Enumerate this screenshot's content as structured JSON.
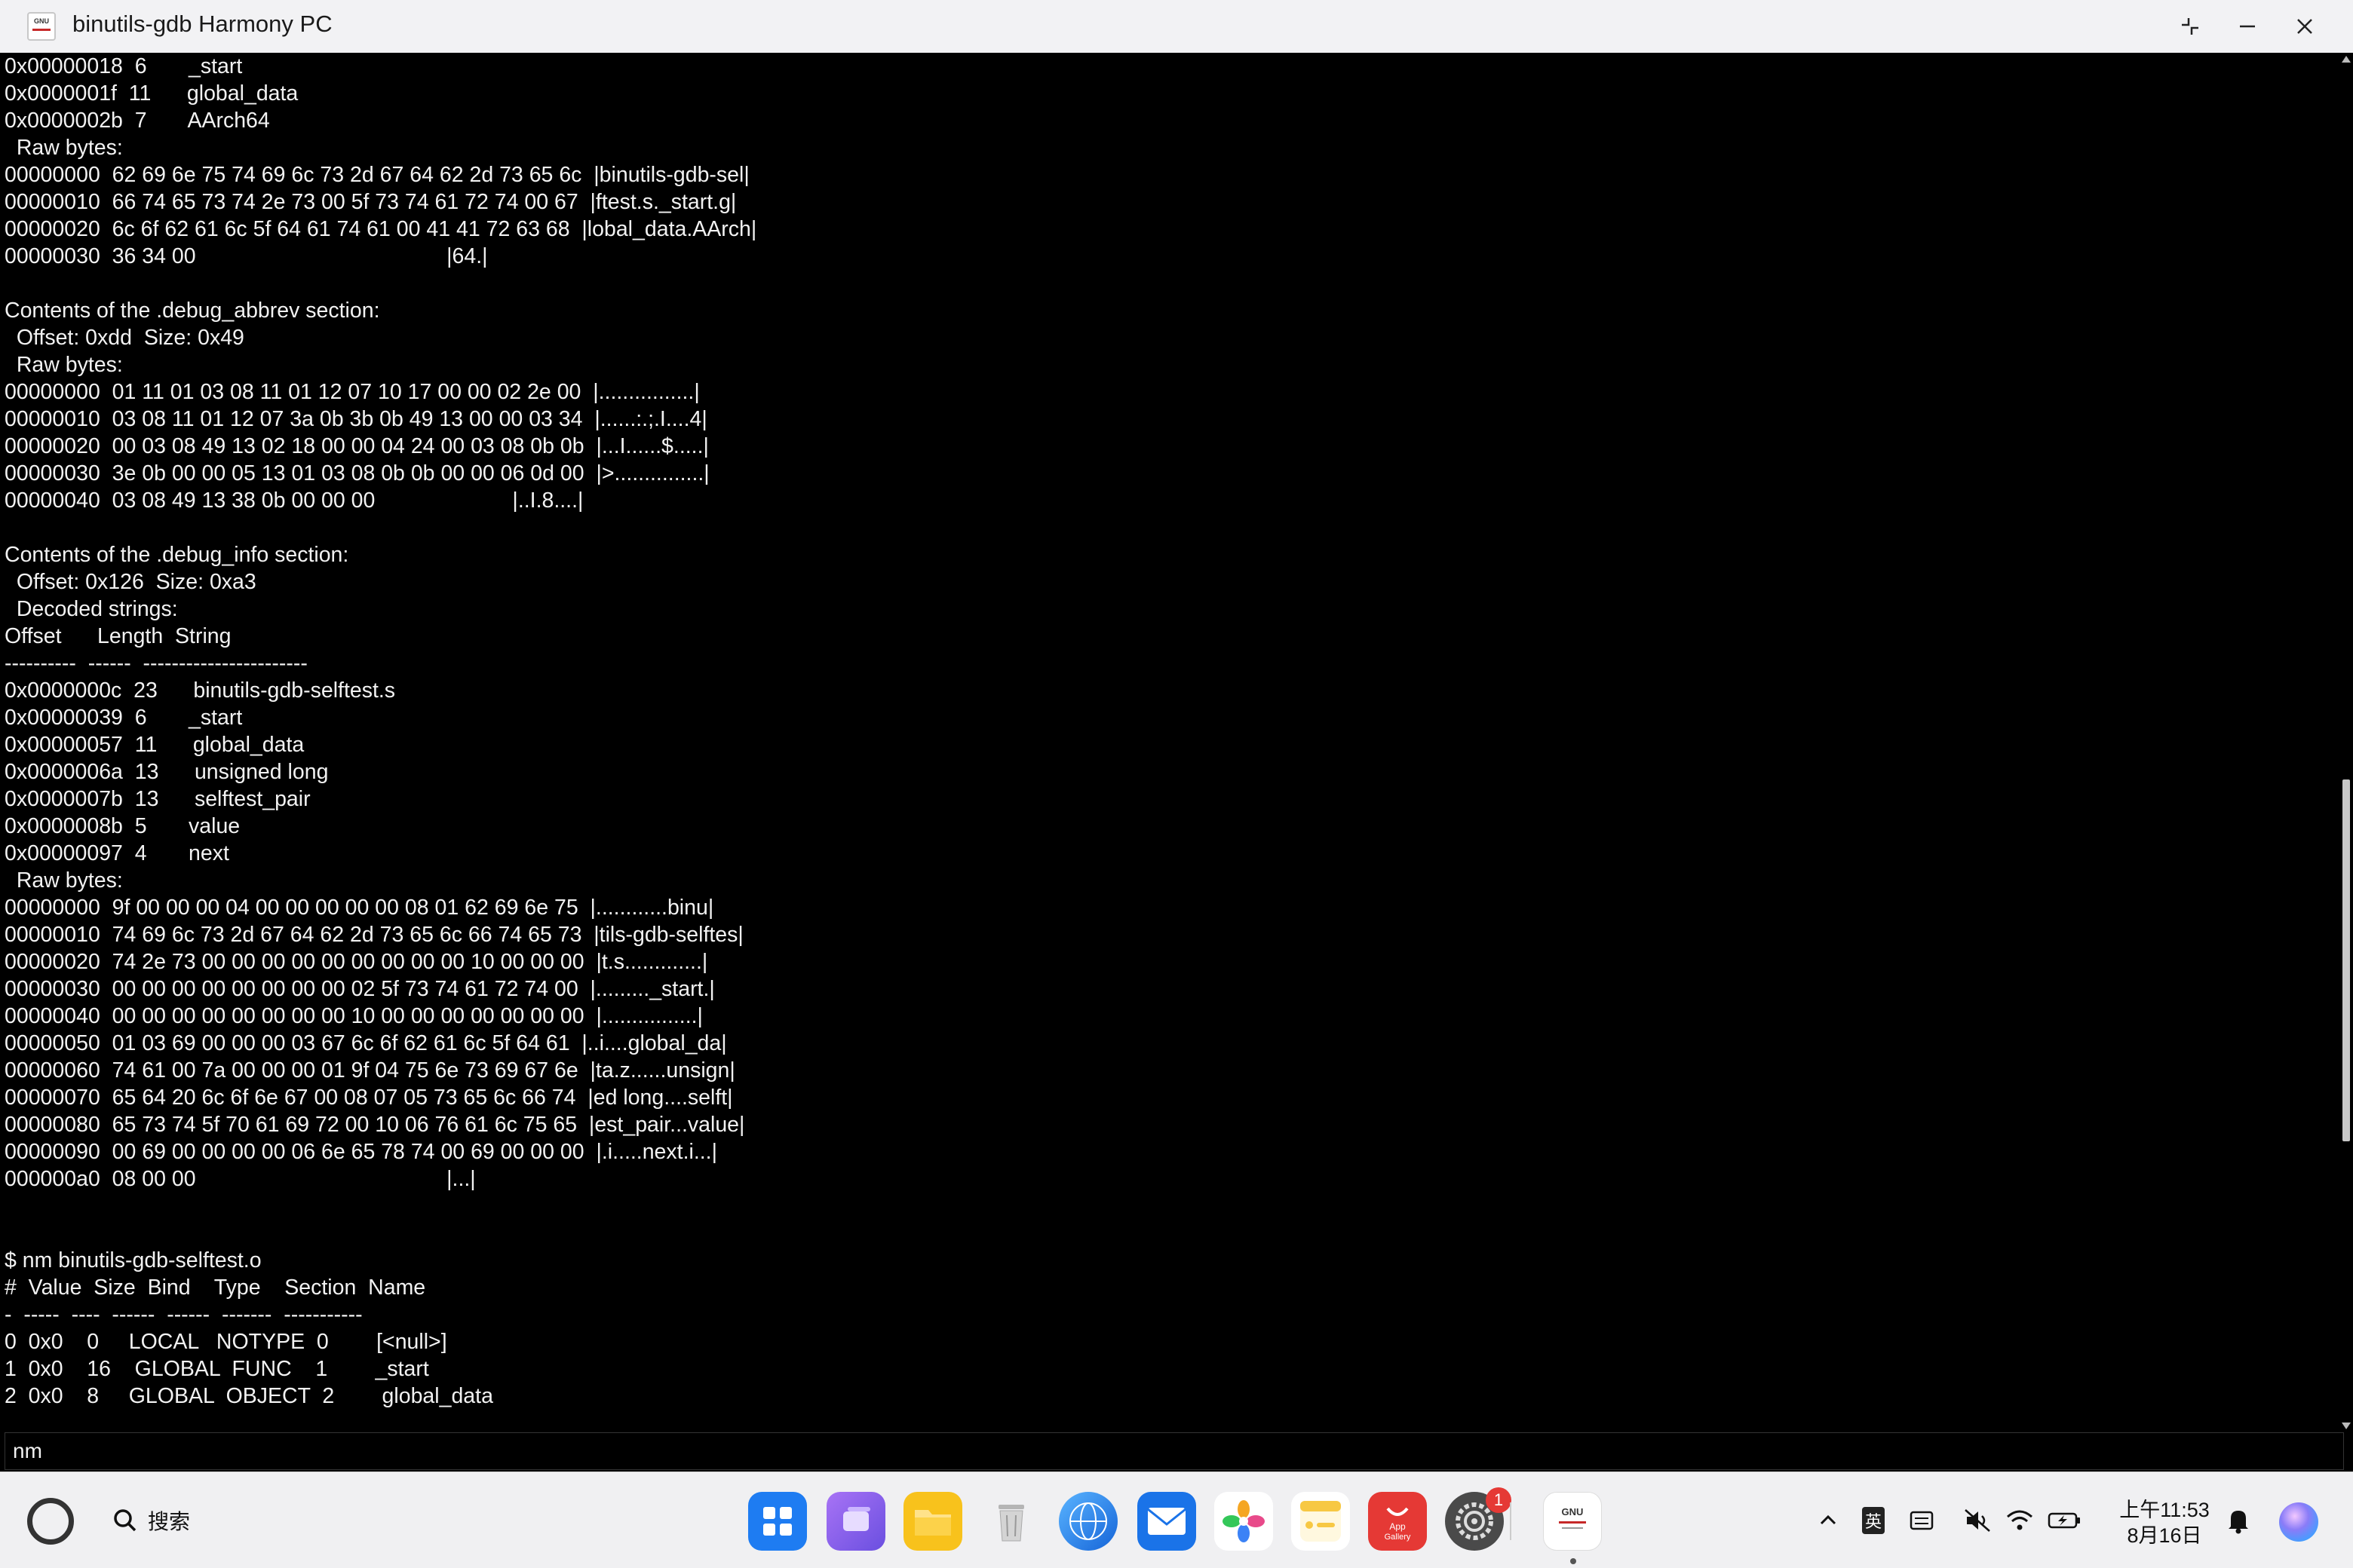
{
  "window": {
    "title": "binutils-gdb Harmony PC",
    "icon_text": "GNU",
    "icon_name": "gnu-app-icon"
  },
  "terminal": {
    "lines": [
      "0x00000018  6       _start",
      "0x0000001f  11      global_data",
      "0x0000002b  7       AArch64",
      "  Raw bytes:",
      "00000000  62 69 6e 75 74 69 6c 73 2d 67 64 62 2d 73 65 6c  |binutils-gdb-sel|",
      "00000010  66 74 65 73 74 2e 73 00 5f 73 74 61 72 74 00 67  |ftest.s._start.g|",
      "00000020  6c 6f 62 61 6c 5f 64 61 74 61 00 41 41 72 63 68  |lobal_data.AArch|",
      "00000030  36 34 00                                          |64.|",
      "",
      "Contents of the .debug_abbrev section:",
      "  Offset: 0xdd  Size: 0x49",
      "  Raw bytes:",
      "00000000  01 11 01 03 08 11 01 12 07 10 17 00 00 02 2e 00  |................|",
      "00000010  03 08 11 01 12 07 3a 0b 3b 0b 49 13 00 00 03 34  |......:.;.I....4|",
      "00000020  00 03 08 49 13 02 18 00 00 04 24 00 03 08 0b 0b  |...I......$.....|",
      "00000030  3e 0b 00 00 05 13 01 03 08 0b 0b 00 00 06 0d 00  |>...............|",
      "00000040  03 08 49 13 38 0b 00 00 00                       |..I.8....|",
      "",
      "Contents of the .debug_info section:",
      "  Offset: 0x126  Size: 0xa3",
      "  Decoded strings:",
      "Offset      Length  String",
      "----------  ------  -----------------------",
      "0x0000000c  23      binutils-gdb-selftest.s",
      "0x00000039  6       _start",
      "0x00000057  11      global_data",
      "0x0000006a  13      unsigned long",
      "0x0000007b  13      selftest_pair",
      "0x0000008b  5       value",
      "0x00000097  4       next",
      "  Raw bytes:",
      "00000000  9f 00 00 00 04 00 00 00 00 00 08 01 62 69 6e 75  |............binu|",
      "00000010  74 69 6c 73 2d 67 64 62 2d 73 65 6c 66 74 65 73  |tils-gdb-selftes|",
      "00000020  74 2e 73 00 00 00 00 00 00 00 00 00 10 00 00 00  |t.s.............|",
      "00000030  00 00 00 00 00 00 00 00 02 5f 73 74 61 72 74 00  |........._start.|",
      "00000040  00 00 00 00 00 00 00 00 10 00 00 00 00 00 00 00  |................|",
      "00000050  01 03 69 00 00 00 03 67 6c 6f 62 61 6c 5f 64 61  |..i....global_da|",
      "00000060  74 61 00 7a 00 00 00 01 9f 04 75 6e 73 69 67 6e  |ta.z......unsign|",
      "00000070  65 64 20 6c 6f 6e 67 00 08 07 05 73 65 6c 66 74  |ed long....selft|",
      "00000080  65 73 74 5f 70 61 69 72 00 10 06 76 61 6c 75 65  |est_pair...value|",
      "00000090  00 69 00 00 00 00 06 6e 65 78 74 00 69 00 00 00  |.i.....next.i...|",
      "000000a0  08 00 00                                          |...|",
      "",
      "",
      "$ nm binutils-gdb-selftest.o",
      "#  Value  Size  Bind    Type    Section  Name",
      "-  -----  ----  ------  ------  -------  -----------",
      "0  0x0    0     LOCAL   NOTYPE  0        [<null>]",
      "1  0x0    16    GLOBAL  FUNC    1        _start",
      "2  0x0    8     GLOBAL  OBJECT  2        global_data"
    ],
    "scroll_position": 0.72
  },
  "command_input": {
    "value": "nm"
  },
  "taskbar": {
    "search_label": "搜索",
    "apps": [
      {
        "name": "app-launcher-icon",
        "color": "#1e7cf2"
      },
      {
        "name": "multitask-icon",
        "color": "#8a5cf0"
      },
      {
        "name": "files-icon",
        "color": "#f8c21c"
      },
      {
        "name": "recycle-bin-icon",
        "color": "#d8d8d8"
      },
      {
        "name": "browser-icon",
        "color": "#1f8ef1"
      },
      {
        "name": "mail-icon",
        "color": "#1a73e8"
      },
      {
        "name": "gallery-icon",
        "color": "#f0a020"
      },
      {
        "name": "notepad-icon",
        "color": "#f7c843"
      },
      {
        "name": "app-gallery-icon",
        "color": "#e53935",
        "label": "App\nGallery"
      },
      {
        "name": "settings-icon",
        "color": "#555555"
      },
      {
        "name": "binutils-gdb-icon",
        "color": "#ffffff",
        "label": "GNU"
      }
    ],
    "settings_badge": "1",
    "ime_label": "英",
    "clock_time": "上午11:53",
    "clock_date": "8月16日"
  }
}
